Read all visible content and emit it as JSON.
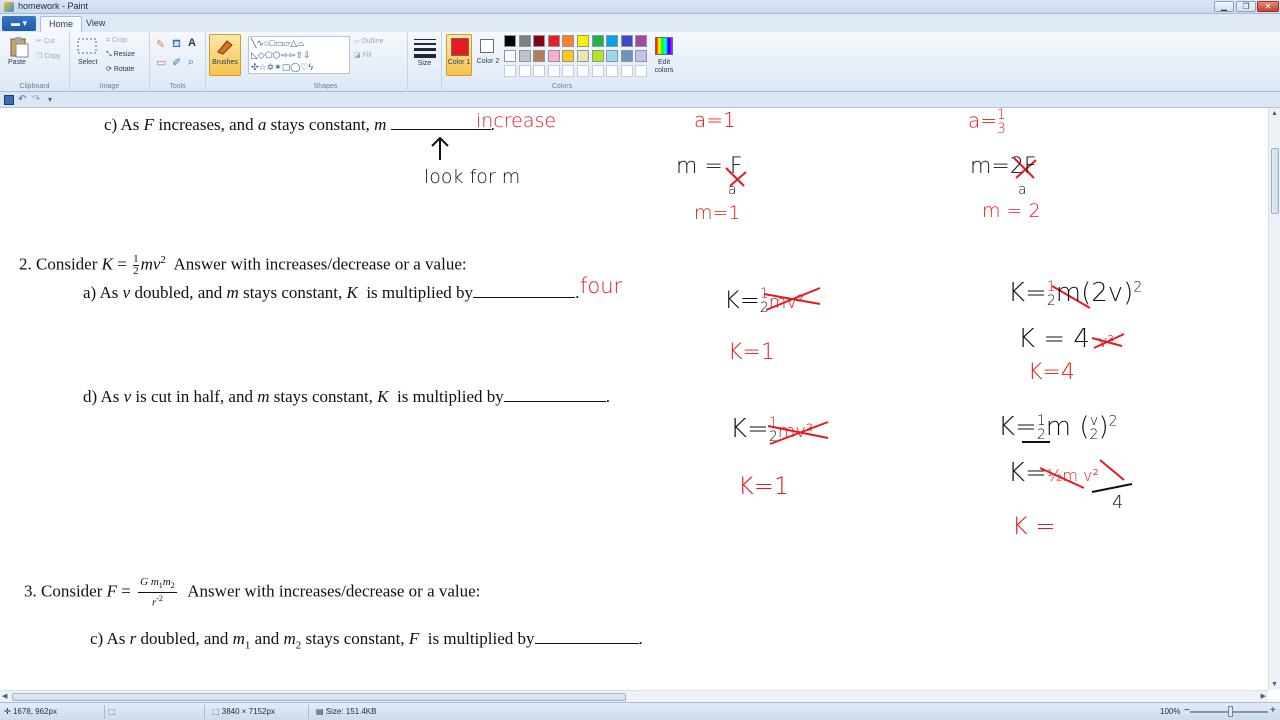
{
  "window": {
    "title": "homework - Paint",
    "minimize": "▁",
    "maximize": "❐",
    "close": "✕"
  },
  "tabs": {
    "file": "▾",
    "home": "Home",
    "view": "View"
  },
  "ribbon": {
    "clipboard": {
      "label": "Clipboard",
      "paste": "Paste",
      "cut": "Cut",
      "copy": "Copy"
    },
    "image": {
      "label": "Image",
      "select": "Select",
      "crop": "Crop",
      "resize": "Resize",
      "rotate": "Rotate"
    },
    "tools": {
      "label": "Tools"
    },
    "brushes": {
      "label": "Brushes"
    },
    "shapes": {
      "label": "Shapes",
      "outline": "Outline",
      "fill": "Fill"
    },
    "size": {
      "label": "Size"
    },
    "colors": {
      "label": "Colors",
      "color1": "Color 1",
      "color2": "Color 2",
      "edit": "Edit colors",
      "color1_value": "#e5191f",
      "color2_value": "#ffffff",
      "row1": [
        "#000000",
        "#7f7f7f",
        "#880015",
        "#ed1c24",
        "#ff7f27",
        "#fff200",
        "#22b14c",
        "#00a2e8",
        "#3f48cc",
        "#a349a4"
      ],
      "row2": [
        "#ffffff",
        "#c3c3c3",
        "#b97a57",
        "#ffaec9",
        "#ffc90e",
        "#efe4b0",
        "#b5e61d",
        "#99d9ea",
        "#7092be",
        "#c8bfe7"
      ]
    }
  },
  "document": {
    "q1c": {
      "prefix": "c) As",
      "var1": "F",
      "mid": "increases, and",
      "var2": "a",
      "suffix": "stays constant,",
      "var3": "m",
      "end": "."
    },
    "q2": {
      "title_prefix": "2. Consider",
      "K": "K",
      "eq": "=",
      "one": "1",
      "two": "2",
      "mv": "mv",
      "sq": "2",
      "title_suffix": "Answer with increases/decrease or a value:"
    },
    "q2a": {
      "prefix": "a) As",
      "v": "v",
      "mid": "doubled, and",
      "m": "m",
      "mid2": "stays constant,",
      "K": "K",
      "suffix": "is multiplied by",
      "end": "."
    },
    "q2d": {
      "prefix": "d) As",
      "v": "v",
      "mid": "is cut in half, and",
      "m": "m",
      "mid2": "stays constant,",
      "K": "K",
      "suffix": "is multiplied by",
      "end": "."
    },
    "q3": {
      "title_prefix": "3. Consider",
      "F": "F",
      "eq": "=",
      "num": "G m",
      "sub1": "1",
      "m2": "m",
      "sub2": "2",
      "den": "r",
      "densq": "-2",
      "title_suffix": "Answer with increases/decrease or a value:"
    },
    "q3c": {
      "prefix": "c) As",
      "r": "r",
      "mid": "doubled, and",
      "m1": "m",
      "s1": "1",
      "and": "and",
      "m2": "m",
      "s2": "2",
      "mid2": "stays constant,",
      "F": "F",
      "suffix": "is multiplied by",
      "end": "."
    }
  },
  "handwriting": {
    "increase": "increase",
    "look_for_m": "look for m",
    "a_eq_1": "a=1",
    "m_eq_F": "m = F",
    "a_small": "a",
    "m_eq_1": "m=1",
    "a_eq_1_3": "a=",
    "third_num": "1",
    "third_den": "3",
    "m_eq_2F": "m=2F",
    "a_small2": "a",
    "m_eq_2": "m = 2",
    "four": "four",
    "k1a": "K=",
    "k1a_frac": "1",
    "k1a_two": "2",
    "k1a_rest": "mv²",
    "k1b": "K=1",
    "k2a": "K=",
    "k2a_frac": "1",
    "k2a_two": "2",
    "k2a_rest": "m(2v)",
    "k2a_sq": "2",
    "k2b": "K = 4",
    "k2b_red": "v²",
    "k2c": "K=4",
    "k3a": "K=",
    "k3a_one": "1",
    "k3a_two": "2",
    "k3a_rest": "mv²",
    "k3b": "K=1",
    "k4a": "K=",
    "k4a_one": "1",
    "k4a_two": "2",
    "k4a_m": "m",
    "k4a_v": "v",
    "k4a_2": "2",
    "k4a_sq": "2",
    "k4b": "K=",
    "k4b_red": "½m v²",
    "k4b_den": "4",
    "k4c": "K ="
  },
  "status": {
    "cursor": "1678, 962px",
    "dimensions": "3840 × 7152px",
    "size": "Size: 151.4KB",
    "zoom": "100%",
    "zoom_minus": "−",
    "zoom_plus": "+"
  }
}
